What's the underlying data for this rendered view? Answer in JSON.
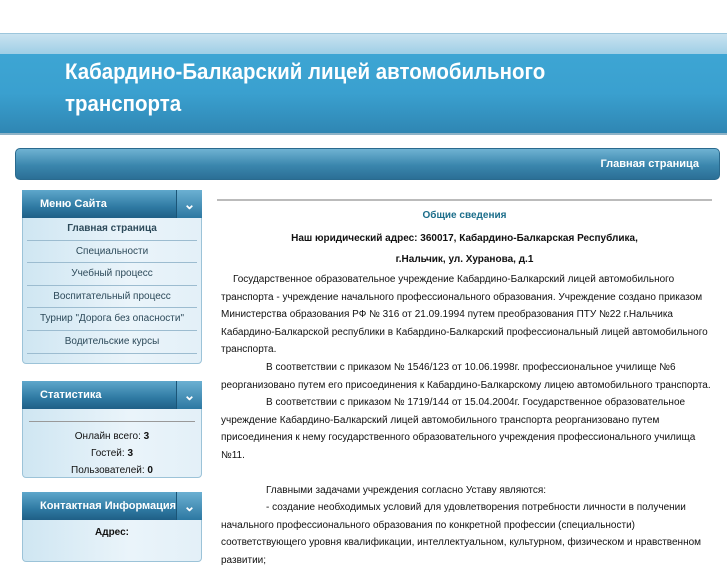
{
  "header": {
    "title": "Кабардино-Балкарский лицей автомобильного транспорта"
  },
  "nav": {
    "home": "Главная страница"
  },
  "menu": {
    "title": "Меню Сайта",
    "items": [
      "Главная страница",
      "Специальности",
      "Учебный процесс",
      "Воспитательный процесс",
      "Турнир \"Дорога без опасности\"",
      "Водительские курсы"
    ]
  },
  "stats": {
    "title": "Статистика",
    "online_label": "Онлайн всего:",
    "online": "3",
    "guests_label": "Гостей:",
    "guests": "3",
    "users_label": "Пользователей:",
    "users": "0"
  },
  "contact": {
    "title": "Контактная Информация",
    "address_label": "Адрес:"
  },
  "content": {
    "title": "Общие сведения",
    "address1": "Наш юридический адрес: 360017, Кабардино-Балкарская Республика,",
    "address2": "г.Нальчик, ул. Хуранова, д.1",
    "p1": "Государственное образовательное учреждение Кабардино-Балкарский лицей автомобильного транспорта - учреждение начального профессионального образования. Учреждение создано приказом Министерства образования РФ № 316 от 21.09.1994 путем преобразования ПТУ №22 г.Нальчика Кабардино-Балкарской республики в Кабардино-Балкарский профессиональный лицей автомобильного транспорта.",
    "p2": "В соответствии с приказом № 1546/123 от 10.06.1998г. профессиональное училище №6 реорганизовано путем его присоединения к Кабардино-Балкарскому лицею автомобильного транспорта.",
    "p3": "В соответствии с приказом № 1719/144 от 15.04.2004г. Государственное образовательное учреждение Кабардино-Балкарский лицей автомобильного транспорта реорганизовано путем присоединения к нему государственного образовательного учреждения профессионального училища №11.",
    "p4": "Главными задачами учреждения согласно Уставу являются:",
    "p5": "- создание необходимых условий для удовлетворения потребности личности в получении начального профессионального образования по конкретной профессии (специальности) соответствующего уровня квалификации, интеллектуальном, культурном, физическом и нравственном развитии;"
  }
}
